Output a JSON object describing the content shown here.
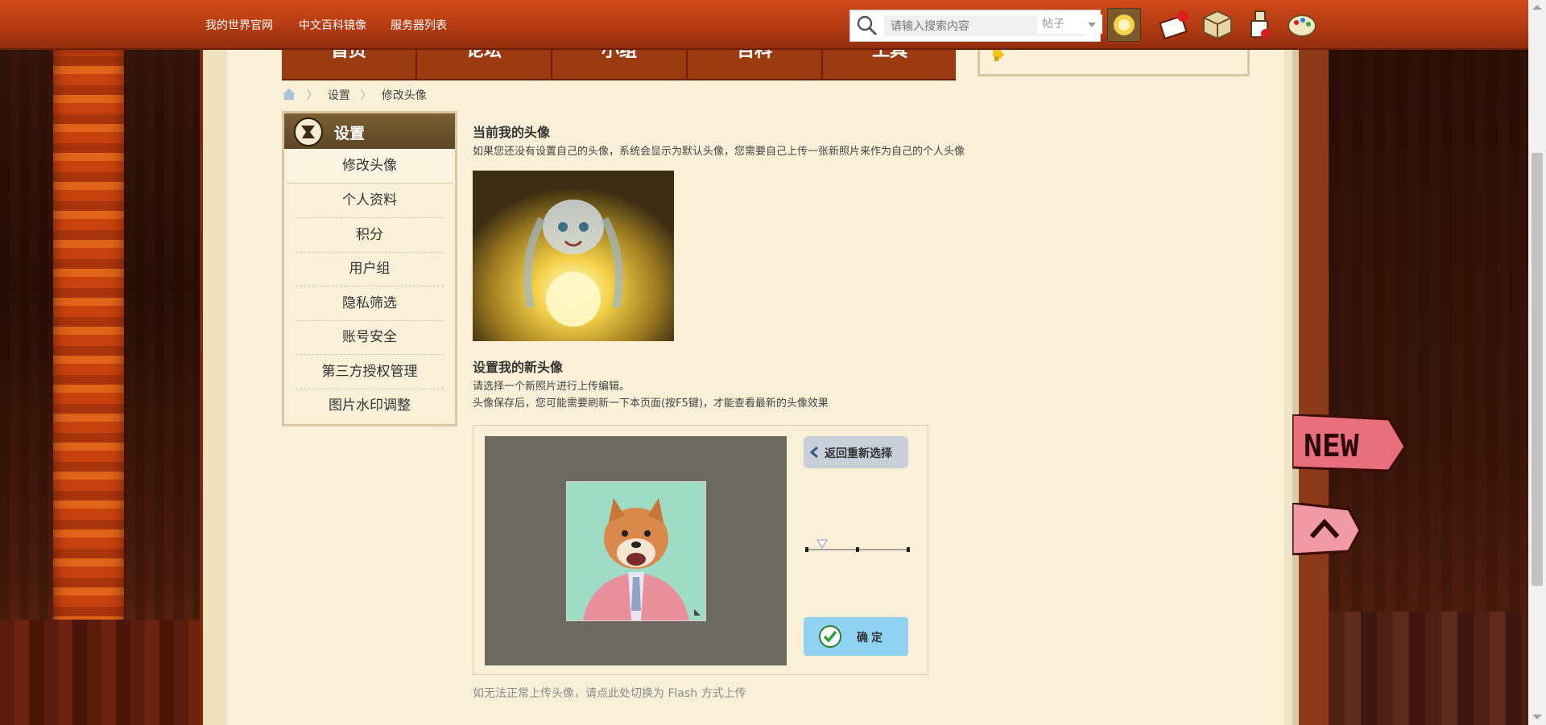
{
  "topbar": {
    "links": [
      "我的世界官网",
      "中文百科镜像",
      "服务器列表"
    ],
    "search": {
      "placeholder": "请输入搜索内容",
      "type_selected": "帖子"
    },
    "icons": [
      "avatar-icon",
      "mail-icon",
      "box-icon",
      "potion-icon",
      "palette-icon"
    ]
  },
  "nav": {
    "tabs": [
      "首页",
      "论坛",
      "小组",
      "百科",
      "工具"
    ]
  },
  "breadcrumb": {
    "items": [
      "设置",
      "修改头像"
    ]
  },
  "sidebar": {
    "title": "设置",
    "items": [
      "修改头像",
      "个人资料",
      "积分",
      "用户组",
      "隐私筛选",
      "账号安全",
      "第三方授权管理",
      "图片水印调整"
    ],
    "active_index": 0
  },
  "main": {
    "current_title": "当前我的头像",
    "current_desc": "如果您还没有设置自己的头像，系统会显示为默认头像，您需要自己上传一张新照片来作为自己的个人头像",
    "new_title": "设置我的新头像",
    "new_desc1": "请选择一个新照片进行上传编辑。",
    "new_desc2": "头像保存后，您可能需要刷新一下本页面(按F5键)，才能查看最新的头像效果",
    "reselect_label": "返回重新选择",
    "confirm_label": "确定",
    "flash_link": "如无法正常上传头像，请点此处切换为 Flash 方式上传"
  },
  "colors": {
    "topbar": "#b23a12",
    "page": "#faf0d7",
    "confirm": "#8fd1f1"
  }
}
